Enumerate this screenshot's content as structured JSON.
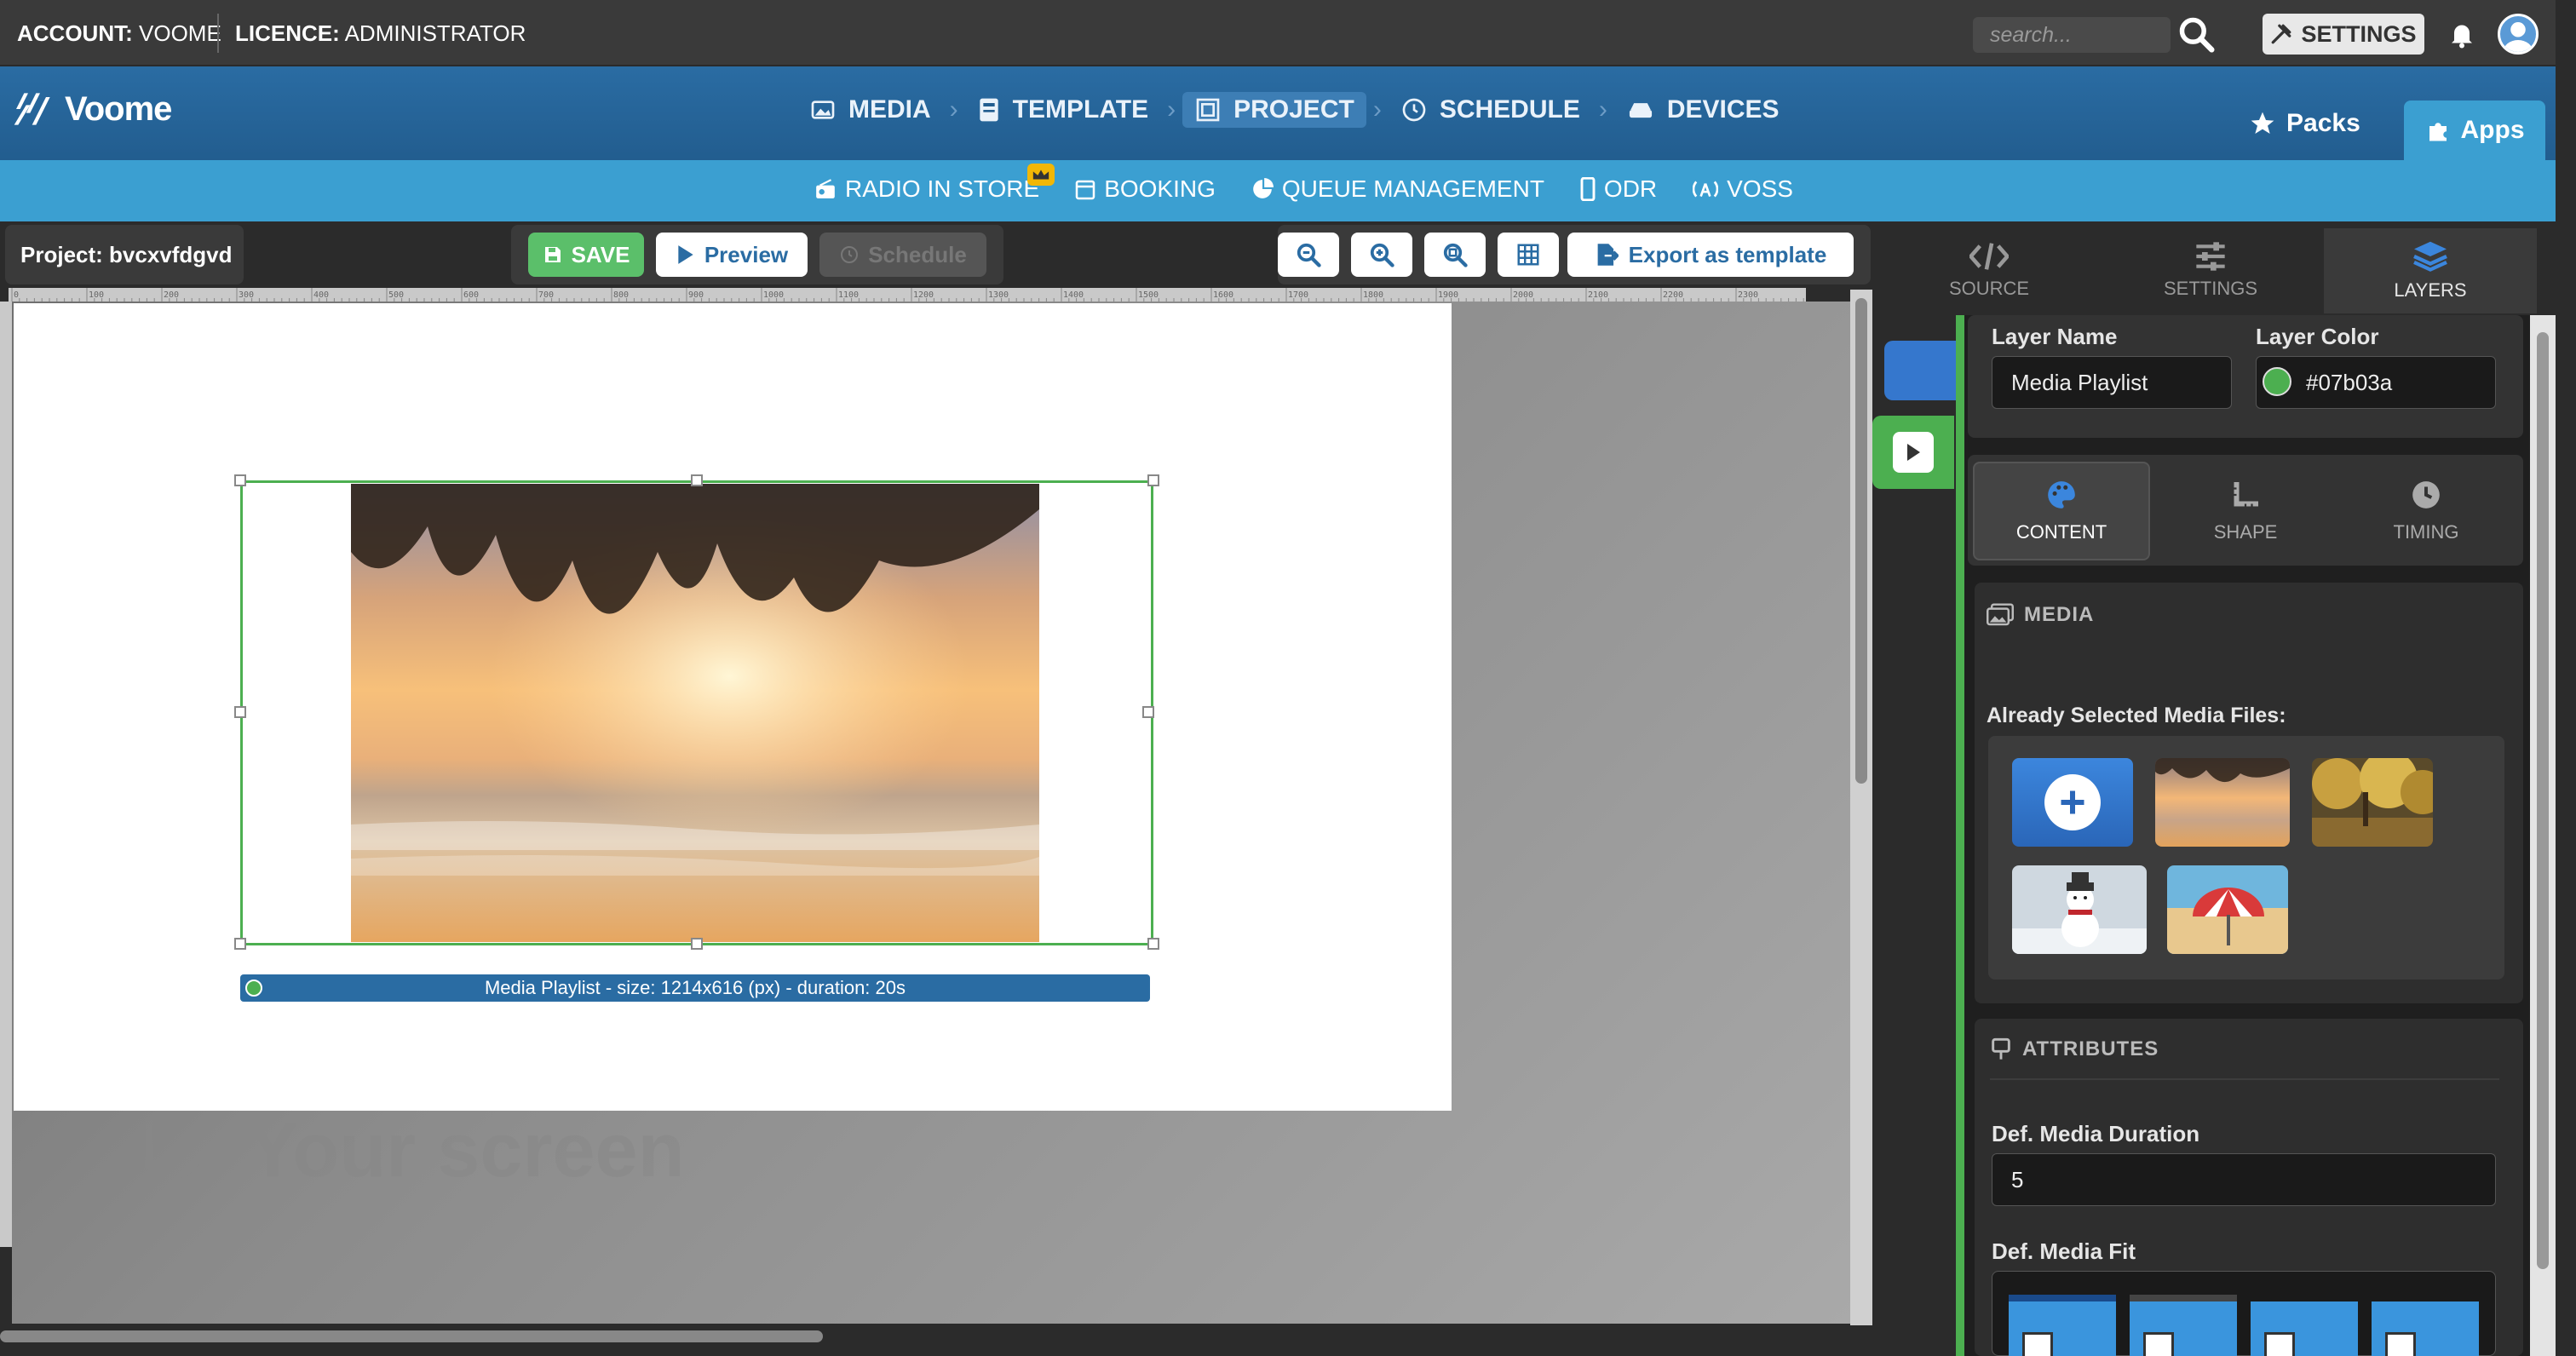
{
  "topbar": {
    "account_label": "ACCOUNT:",
    "account_value": "VOOME",
    "licence_label": "LICENCE:",
    "licence_value": "ADMINISTRATOR",
    "search_placeholder": "search...",
    "settings_label": "SETTINGS"
  },
  "logo": {
    "text": "Voome"
  },
  "nav": {
    "items": [
      {
        "label": "MEDIA"
      },
      {
        "label": "TEMPLATE"
      },
      {
        "label": "PROJECT"
      },
      {
        "label": "SCHEDULE"
      },
      {
        "label": "DEVICES"
      }
    ],
    "active": "PROJECT",
    "packs_label": "Packs",
    "apps_label": "Apps"
  },
  "apps_nav": {
    "items": [
      {
        "label": "RADIO IN STORE"
      },
      {
        "label": "BOOKING"
      },
      {
        "label": "QUEUE MANAGEMENT"
      },
      {
        "label": "ODR"
      },
      {
        "label": "VOSS"
      }
    ]
  },
  "toolbar": {
    "project_label": "Project: bvcxvfdgvd",
    "save_label": "SAVE",
    "preview_label": "Preview",
    "schedule_label": "Schedule",
    "export_label": "Export as template"
  },
  "ruler": {
    "ticks": [
      "0",
      "100",
      "200",
      "300",
      "400",
      "500",
      "600",
      "700",
      "800",
      "900",
      "1000",
      "1100",
      "1200",
      "1300",
      "1400",
      "1500",
      "1600",
      "1700",
      "1800",
      "1900",
      "2000",
      "2100",
      "2200",
      "2300"
    ]
  },
  "canvas": {
    "screen_caption": "Your screen",
    "layer_label": "Media Playlist - size: 1214x616 (px) - duration: 20s"
  },
  "panel_tabs": [
    {
      "label": "SOURCE"
    },
    {
      "label": "SETTINGS"
    },
    {
      "label": "LAYERS"
    }
  ],
  "panel_tabs_active": "LAYERS",
  "layer": {
    "name_label": "Layer Name",
    "name_value": "Media Playlist",
    "color_label": "Layer Color",
    "color_value": "#07b03a"
  },
  "sub_tabs": [
    {
      "label": "CONTENT"
    },
    {
      "label": "SHAPE"
    },
    {
      "label": "TIMING"
    }
  ],
  "sub_tabs_active": "CONTENT",
  "media_section": {
    "title": "MEDIA",
    "selected_label": "Already Selected Media Files:"
  },
  "attributes_section": {
    "title": "ATTRIBUTES",
    "duration_label": "Def. Media Duration",
    "duration_value": "5",
    "fit_label": "Def. Media Fit"
  },
  "colors": {
    "accent_blue": "#2a6ca3",
    "apps_blue": "#3b9fd1",
    "layer_green": "#4caf50"
  }
}
